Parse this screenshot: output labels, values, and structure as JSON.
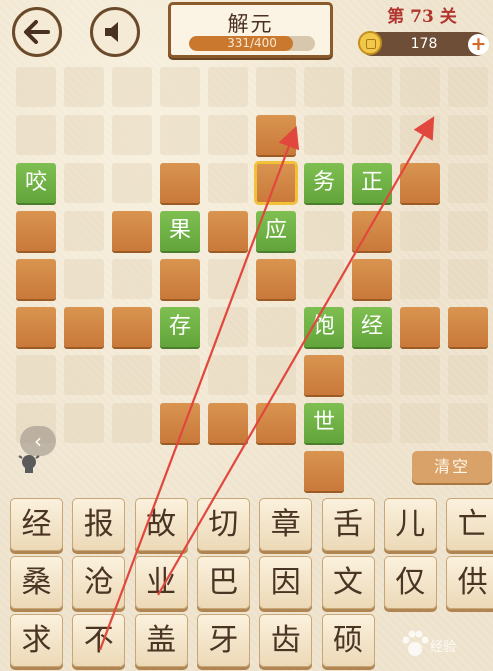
{
  "header": {
    "title": "解元",
    "progress_text": "331/400",
    "progress_fraction": 0.8275,
    "level_text": "第 73 关",
    "coins": "178",
    "plus": "+"
  },
  "grid": {
    "green_cells": [
      {
        "char": "咬",
        "row": 2,
        "col": 0
      },
      {
        "char": "务",
        "row": 2,
        "col": 6
      },
      {
        "char": "正",
        "row": 2,
        "col": 7
      },
      {
        "char": "果",
        "row": 3,
        "col": 3
      },
      {
        "char": "应",
        "row": 3,
        "col": 5
      },
      {
        "char": "存",
        "row": 5,
        "col": 3
      },
      {
        "char": "饱",
        "row": 5,
        "col": 6
      },
      {
        "char": "经",
        "row": 5,
        "col": 7
      },
      {
        "char": "世",
        "row": 7,
        "col": 6
      }
    ]
  },
  "tools": {
    "back": "‹",
    "clear": "清空"
  },
  "tiles": [
    [
      "经",
      "报",
      "故",
      "切",
      "章",
      "舌",
      "儿",
      "亡"
    ],
    [
      "桑",
      "沧",
      "业",
      "巴",
      "因",
      "文",
      "仅",
      "供"
    ],
    [
      "求",
      "不",
      "盖",
      "牙",
      "齿",
      "硕"
    ]
  ],
  "colors": {
    "green_cell": "#6aaf40",
    "brown_cell": "#d08a46",
    "selected_outline": "#f1c13a",
    "arrow": "#e2473d",
    "level_text": "#b0352c"
  },
  "watermark": "经验"
}
